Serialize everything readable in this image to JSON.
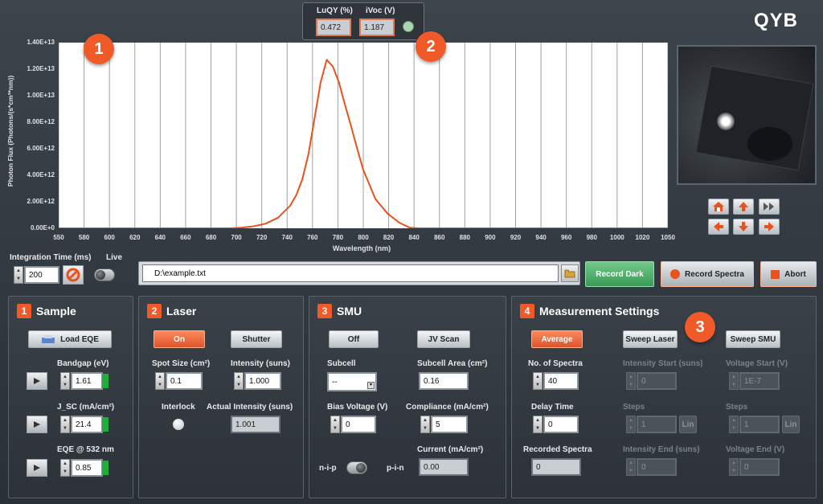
{
  "brand": "QYB",
  "badges": [
    "1",
    "2",
    "3"
  ],
  "status": {
    "luqy_label": "LuQY (%)",
    "luqy_value": "0.472",
    "ivoc_label": "iVoc (V)",
    "ivoc_value": "1.187",
    "led_color": "#a9d8b0"
  },
  "chart_data": {
    "type": "line",
    "xlabel": "Wavelength (nm)",
    "ylabel": "Photon Flux (Photons/(s*cm²*nm))",
    "xlim": [
      550,
      1050
    ],
    "ylim": [
      0,
      14000000000000.0
    ],
    "x_ticks": [
      "550",
      "580",
      "600",
      "620",
      "640",
      "660",
      "680",
      "700",
      "720",
      "740",
      "760",
      "780",
      "800",
      "820",
      "840",
      "860",
      "880",
      "900",
      "920",
      "940",
      "960",
      "980",
      "1000",
      "1020",
      "1050"
    ],
    "y_ticks": [
      "0.00E+0",
      "2.00E+12",
      "4.00E+12",
      "6.00E+12",
      "8.00E+12",
      "1.00E+13",
      "1.20E+13",
      "1.40E+13"
    ],
    "grid": true,
    "series": [
      {
        "color": "#e8521c",
        "x": [
          550,
          690,
          700,
          710,
          720,
          730,
          740,
          745,
          750,
          755,
          760,
          765,
          770,
          775,
          780,
          785,
          790,
          795,
          800,
          810,
          820,
          830,
          838,
          845,
          1050
        ],
        "y": [
          0,
          0,
          50000000000.0,
          150000000000.0,
          350000000000.0,
          800000000000.0,
          1700000000000.0,
          2500000000000.0,
          3700000000000.0,
          5600000000000.0,
          8300000000000.0,
          11000000000000.0,
          12700000000000.0,
          12200000000000.0,
          11000000000000.0,
          9300000000000.0,
          7700000000000.0,
          6000000000000.0,
          4400000000000.0,
          2200000000000.0,
          1100000000000.0,
          400000000000.0,
          50000000000.0,
          0,
          0
        ]
      }
    ]
  },
  "controls": {
    "integration_label": "Integration Time (ms)",
    "integration_value": "200",
    "live_label": "Live",
    "file_path": "D:\\example.txt",
    "record_dark": "Record Dark",
    "record_spectra": "Record Spectra",
    "abort": "Abort"
  },
  "sample": {
    "num": "1",
    "title": "Sample",
    "load_eqe": "Load EQE",
    "bandgap_label": "Bandgap (eV)",
    "bandgap_value": "1.61",
    "jsc_label": "J_SC (mA/cm²)",
    "jsc_value": "21.4",
    "eqe_label": "EQE @ 532 nm",
    "eqe_value": "0.85"
  },
  "laser": {
    "num": "2",
    "title": "Laser",
    "on": "On",
    "shutter": "Shutter",
    "spot_label": "Spot Size (cm²)",
    "spot_value": "0.1",
    "intensity_label": "Intensity (suns)",
    "intensity_value": "1.000",
    "interlock_label": "Interlock",
    "actual_label": "Actual Intensity (suns)",
    "actual_value": "1.001"
  },
  "smu": {
    "num": "3",
    "title": "SMU",
    "off": "Off",
    "jv_scan": "JV Scan",
    "subcell_label": "Subcell",
    "subcell_value": "--",
    "area_label": "Subcell Area (cm²)",
    "area_value": "0.16",
    "bias_label": "Bias Voltage (V)",
    "bias_value": "0",
    "compliance_label": "Compliance (mA/cm²)",
    "compliance_value": "5",
    "current_label": "Current (mA/cm²)",
    "current_value": "0.00",
    "nip": "n-i-p",
    "pin": "p-i-n"
  },
  "meas": {
    "num": "4",
    "title": "Measurement Settings",
    "average": "Average",
    "sweep_laser": "Sweep Laser",
    "sweep_smu": "Sweep SMU",
    "nspectra_label": "No. of Spectra",
    "nspectra_value": "40",
    "delay_label": "Delay Time",
    "delay_value": "0",
    "recorded_label": "Recorded Spectra",
    "recorded_value": "0",
    "istart_label": "Intensity Start (suns)",
    "istart_value": "0",
    "isteps_label": "Steps",
    "isteps_value": "1",
    "iend_label": "Intensity End (suns)",
    "iend_value": "0",
    "vstart_label": "Voltage Start (V)",
    "vstart_value": "1E-7",
    "vsteps_label": "Steps",
    "vsteps_value": "1",
    "vend_label": "Voltage End (V)",
    "vend_value": "0",
    "lin": "Lin"
  }
}
